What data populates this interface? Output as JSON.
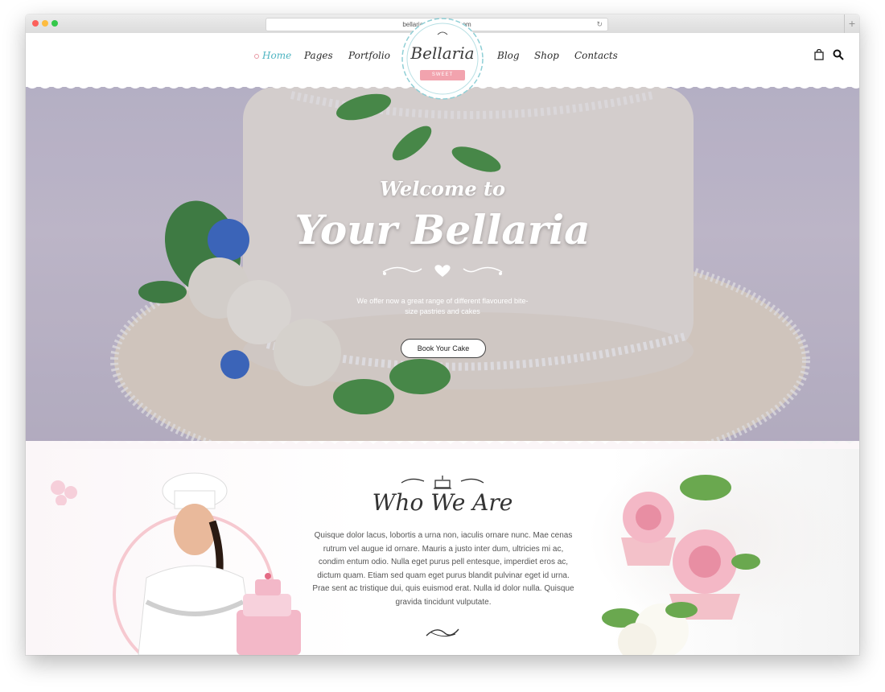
{
  "browser": {
    "url": "bellaria.cwsthemes.com"
  },
  "nav": {
    "left": [
      "Home",
      "Pages",
      "Portfolio"
    ],
    "right": [
      "Blog",
      "Shop",
      "Contacts"
    ],
    "active": "Home"
  },
  "logo": {
    "title": "Bellaria",
    "subtitle": "SWEET BAKERY"
  },
  "hero": {
    "welcome": "Welcome to",
    "title": "Your Bellaria",
    "text": "We offer now a great range of different flavoured bite-size pastries and cakes",
    "button": "Book Your Cake"
  },
  "about": {
    "title": "Who We Are",
    "text": "Quisque dolor lacus, lobortis a urna non, iaculis ornare nunc. Mae cenas rutrum vel augue id ornare. Mauris a justo inter dum, ultricies mi ac, condim entum odio. Nulla eget purus pell entesque, imperdiet eros ac, dictum quam. Etiam sed quam eget purus blandit pulvinar eget id urna. Prae sent ac tristique dui, quis euismod erat. Nulla id dolor nulla. Quisque gravida tincidunt vulputate."
  },
  "colors": {
    "accent": "#4fb5c2",
    "pink": "#f2a3ae",
    "text": "#333333"
  },
  "icons": {
    "cart": "shopping-bag-icon",
    "search": "search-icon"
  }
}
